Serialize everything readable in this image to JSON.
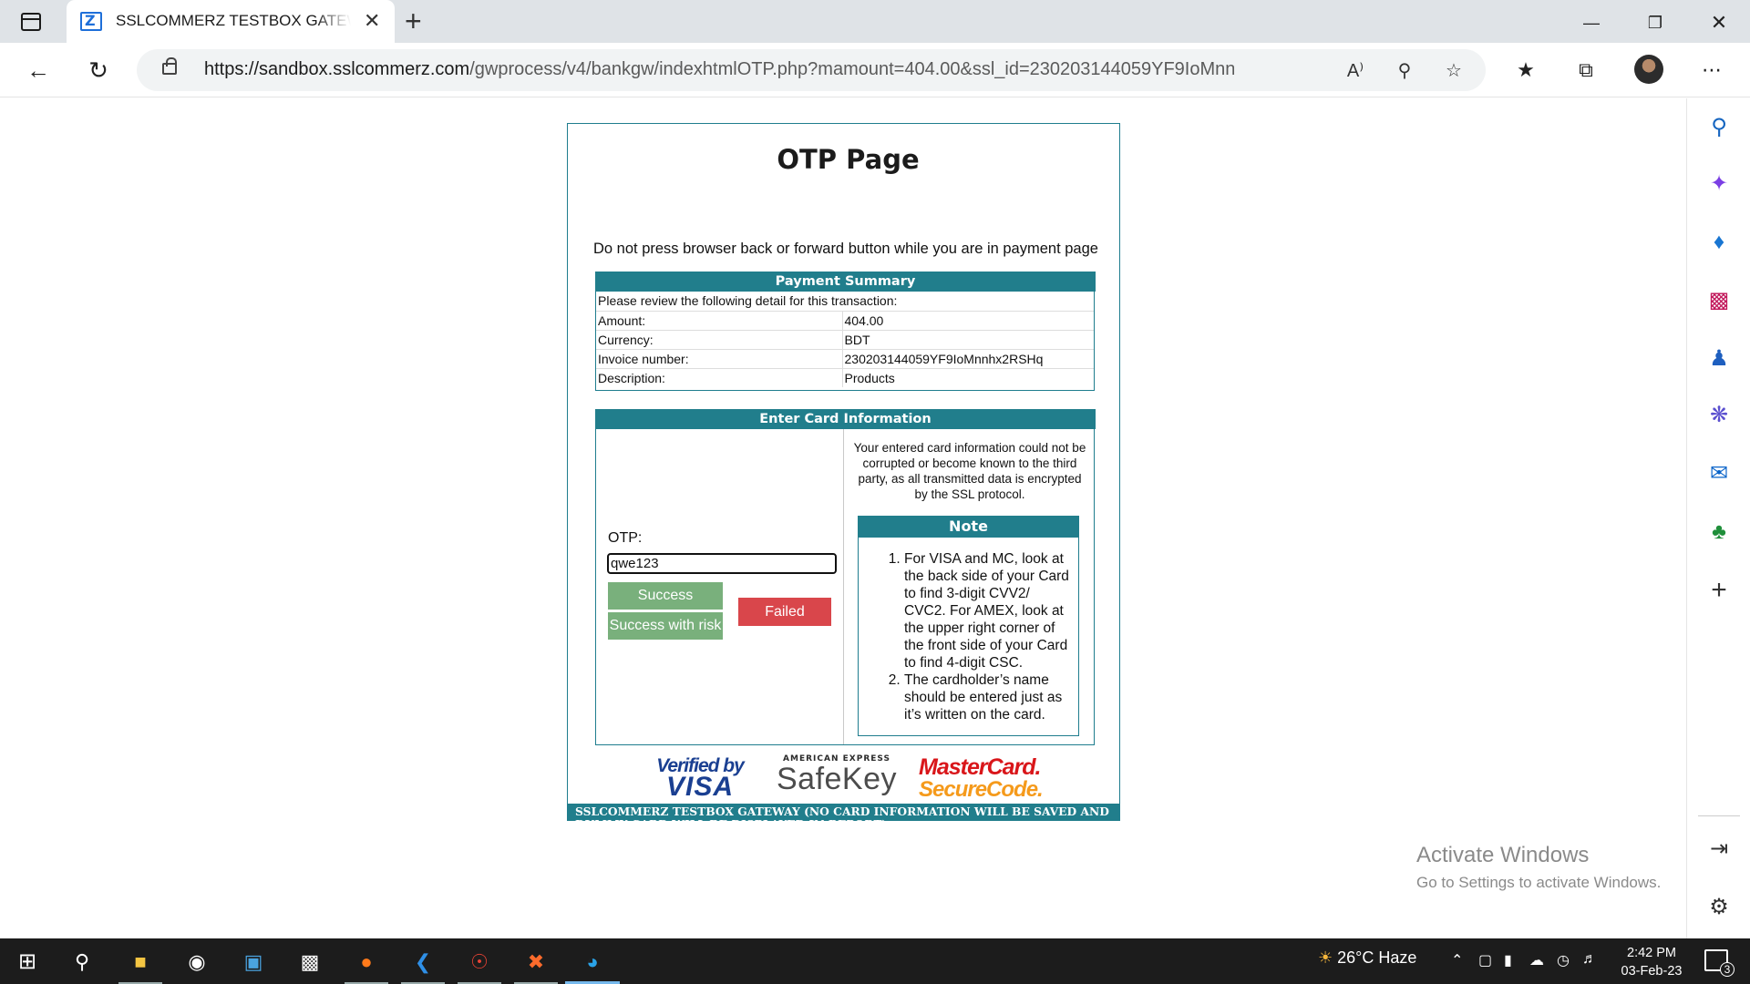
{
  "browser": {
    "tab_title": "SSLCOMMERZ TESTBOX GATEWAY",
    "url_domain": "https://sandbox.sslcommerz.com",
    "url_path": "/gwprocess/v4/bankgw/indexhtmlOTP.php?mamount=404.00&ssl_id=230203144059YF9IoMnnhx...",
    "new_tab_symbol": "+",
    "close_symbol": "✕"
  },
  "page": {
    "title": "OTP Page",
    "warning": "Do not press browser back or forward button while you are in payment page"
  },
  "summary": {
    "heading": "Payment Summary",
    "intro": "Please review the following detail for this transaction:",
    "rows": [
      {
        "label": "Amount:",
        "value": "404.00"
      },
      {
        "label": "Currency:",
        "value": "BDT"
      },
      {
        "label": "Invoice number:",
        "value": "230203144059YF9IoMnnhx2RSHq"
      },
      {
        "label": "Description:",
        "value": "Products"
      }
    ]
  },
  "card": {
    "heading": "Enter Card Information",
    "otp_label": "OTP:",
    "otp_value": "qwe123",
    "success_label": "Success",
    "success_risk_label": "Success with risk",
    "failed_label": "Failed",
    "security_note": "Your entered card information could not be corrupted or become known to the third party, as all transmitted data is encrypted by the SSL protocol.",
    "note_heading": "Note",
    "notes": [
      "For VISA and MC, look at the back side of your Card to find 3-digit CVV2/ CVC2. For AMEX, look at the upper right corner of the front side of your Card to find 4-digit CSC.",
      "The cardholder’s name should be entered just as it’s written on the card."
    ]
  },
  "logos": {
    "visa_line1": "Verified by",
    "visa_line2": "VISA",
    "amex_line1": "AMERICAN EXPRESS",
    "amex_line2": "SafeKey",
    "mc_line1": "MasterCard.",
    "mc_line2": "SecureCode."
  },
  "footer": "SSLCOMMERZ TESTBOX GATEWAY (NO CARD INFORMATION WILL BE SAVED AND DUMMY CARD WILL BE DISPLAYED IN REPORT)",
  "watermark": {
    "line1": "Activate Windows",
    "line2": "Go to Settings to activate Windows."
  },
  "taskbar": {
    "weather": "26°C  Haze",
    "time": "2:42 PM",
    "date": "03-Feb-23",
    "notifications": "3"
  },
  "colors": {
    "accent_teal": "#217e8c",
    "success_green": "#79b07c",
    "failed_red": "#d9464b"
  }
}
